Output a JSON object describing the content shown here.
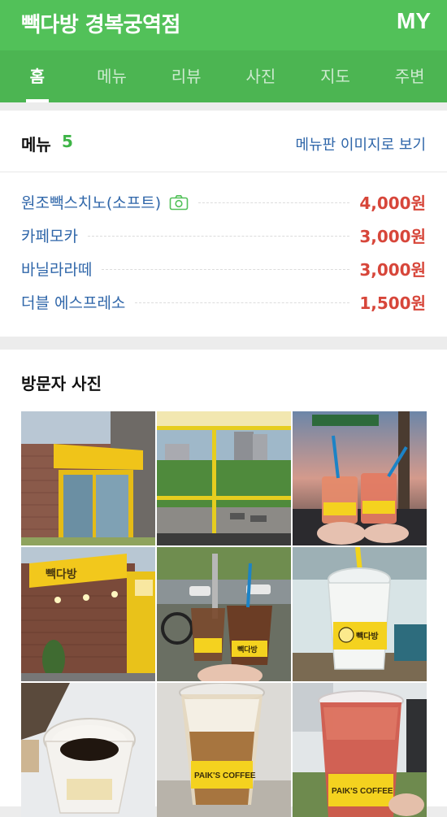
{
  "header": {
    "title": "빽다방 경복궁역점",
    "my_label": "MY"
  },
  "tabs": [
    {
      "label": "홈",
      "active": true
    },
    {
      "label": "메뉴",
      "active": false
    },
    {
      "label": "리뷰",
      "active": false
    },
    {
      "label": "사진",
      "active": false
    },
    {
      "label": "지도",
      "active": false
    },
    {
      "label": "주변",
      "active": false
    }
  ],
  "menu": {
    "label": "메뉴",
    "count": "5",
    "view_link": "메뉴판 이미지로 보기",
    "items": [
      {
        "name": "원조빽스치노(소프트)",
        "price": "4,000원",
        "has_photo": true
      },
      {
        "name": "카페모카",
        "price": "3,000원",
        "has_photo": false
      },
      {
        "name": "바닐라라떼",
        "price": "3,000원",
        "has_photo": false
      },
      {
        "name": "더블 에스프레소",
        "price": "1,500원",
        "has_photo": false
      }
    ]
  },
  "photos": {
    "heading": "방문자 사진",
    "items": [
      {
        "subject": "storefront-exterior"
      },
      {
        "subject": "window-view"
      },
      {
        "subject": "drinks-street-dusk",
        "cup_label": "빽다방"
      },
      {
        "subject": "store-signage",
        "sign_text": "빽다방"
      },
      {
        "subject": "iced-drinks-street",
        "cup_label": "빽다방"
      },
      {
        "subject": "frappe-cup",
        "cup_label": "빽다방"
      },
      {
        "subject": "espresso-paper-cup"
      },
      {
        "subject": "iced-latte",
        "cup_label": "PAIK'S COFFEE"
      },
      {
        "subject": "red-iced-drink",
        "cup_label": "PAIK'S COFFEE"
      }
    ]
  },
  "colors": {
    "brand_green": "#52c159",
    "link_blue": "#2f66a9",
    "price_red": "#d7463a",
    "count_green": "#3db446",
    "cup_yellow": "#f4d21f"
  }
}
